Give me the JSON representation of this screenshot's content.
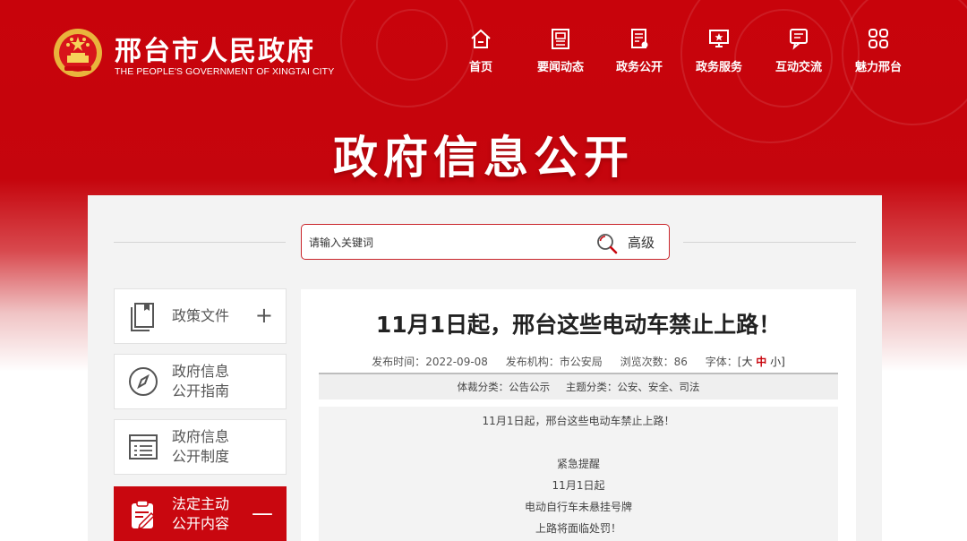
{
  "header": {
    "site_title": "邢台市人民政府",
    "site_subtitle": "THE PEOPLE'S GOVERNMENT OF XINGTAI CITY",
    "nav": [
      {
        "label": "首页",
        "icon": "home-icon"
      },
      {
        "label": "要闻动态",
        "icon": "newspaper-icon"
      },
      {
        "label": "政务公开",
        "icon": "document-icon"
      },
      {
        "label": "政务服务",
        "icon": "service-monitor-icon"
      },
      {
        "label": "互动交流",
        "icon": "chat-icon"
      },
      {
        "label": "魅力邢台",
        "icon": "grid-icon"
      }
    ],
    "hero_title": "政府信息公开"
  },
  "search": {
    "placeholder": "请输入关键词",
    "advanced_label": "高级"
  },
  "sidebar": {
    "items": [
      {
        "label_line1": "政策文件",
        "label_line2": "",
        "toggle": "+",
        "icon": "policy-document-icon"
      },
      {
        "label_line1": "政府信息",
        "label_line2": "公开指南",
        "toggle": "",
        "icon": "compass-icon"
      },
      {
        "label_line1": "政府信息",
        "label_line2": "公开制度",
        "toggle": "",
        "icon": "list-icon"
      },
      {
        "label_line1": "法定主动",
        "label_line2": "公开内容",
        "toggle": "—",
        "icon": "clipboard-edit-icon"
      }
    ]
  },
  "article": {
    "title": "11月1日起，邢台这些电动车禁止上路！",
    "publish_time_label": "发布时间：",
    "publish_time": "2022-09-08",
    "publisher_label": "发布机构：",
    "publisher": "市公安局",
    "views_label": "浏览次数：",
    "views": "86",
    "font_label": "字体：[",
    "font_large": "大",
    "font_medium": "中",
    "font_small": "小]",
    "genre_label": "体裁分类：",
    "genre": "公告公示",
    "topic_label": "主题分类：",
    "topic": "公安、安全、司法",
    "body_lines": [
      "11月1日起，邢台这些电动车禁止上路！",
      "",
      "紧急提醒",
      "11月1日起",
      "电动自行车未悬挂号牌",
      "上路将面临处罚！"
    ]
  },
  "colors": {
    "brand_red": "#c8030b",
    "active_red": "#c9070f",
    "emblem_gold": "#f4c430"
  }
}
